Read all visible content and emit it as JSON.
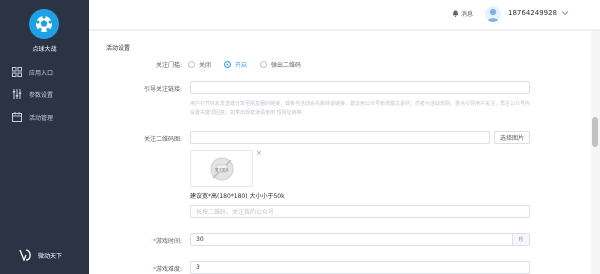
{
  "sidebar": {
    "logo_text": "点球大战",
    "items": [
      {
        "label": "应用入口",
        "icon": "grid-icon"
      },
      {
        "label": "参数设置",
        "icon": "sliders-icon"
      },
      {
        "label": "活动管理",
        "icon": "calendar-icon"
      }
    ],
    "brand": "微动天下"
  },
  "header": {
    "message_label": "消息",
    "phone": "18764249928"
  },
  "form": {
    "section_title": "活动设置",
    "follow_gate": {
      "label": "关注门槛:",
      "options": [
        "关闭",
        "开启",
        "弹出二维码"
      ],
      "selected": "开启"
    },
    "guide_link": {
      "label": "引导关注链接:",
      "value": "",
      "help": "用户打开好友发送或分享至朋友圈的链接，或参与活动会先跳转该链接，建议用公众号新增图文素材，仿者为活动规则、重点引导用户关注，再在公众号内设置关键词回复。如果出现错误请使用 短网址转换"
    },
    "qrcode": {
      "label": "关注二维码图:",
      "value": "",
      "button": "选择图片",
      "placeholder_text": "暂无图片",
      "size_note": "建议宽*高(180*180) 大小小于50k",
      "desc_placeholder": "长按二维码，关注我的公众号"
    },
    "game_time": {
      "label": "游戏时间:",
      "value": "30",
      "unit": "秒"
    },
    "game_difficulty": {
      "label": "游戏难度:",
      "value": "3"
    }
  },
  "colors": {
    "sidebar_bg": "#2c3344",
    "logo": "#1ea2e5",
    "accent": "#409eff",
    "required": "#f56c6c"
  }
}
